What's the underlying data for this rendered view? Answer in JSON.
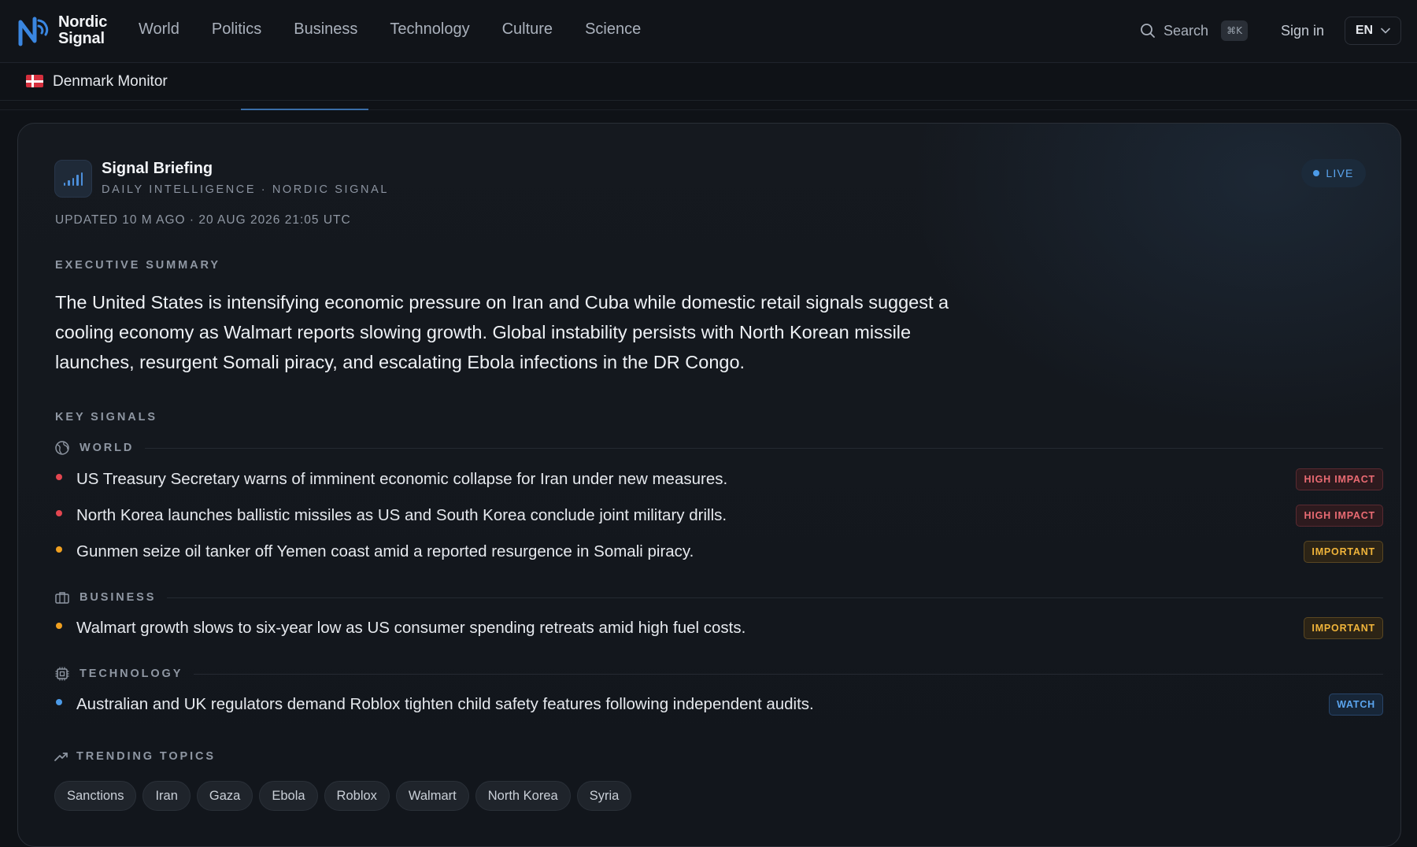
{
  "brand": {
    "name_line1": "Nordic",
    "name_line2": "Signal"
  },
  "nav": {
    "items": [
      "World",
      "Politics",
      "Business",
      "Technology",
      "Culture",
      "Science"
    ]
  },
  "header": {
    "search_label": "Search",
    "search_shortcut": "⌘K",
    "signin_label": "Sign in",
    "language": "EN"
  },
  "subbar": {
    "title": "Denmark Monitor"
  },
  "briefing": {
    "title": "Signal Briefing",
    "subtitle": "DAILY INTELLIGENCE · NORDIC SIGNAL",
    "live_label": "LIVE",
    "updated": "UPDATED 10 M AGO · 20 AUG 2026 21:05 UTC",
    "summary_label": "EXECUTIVE SUMMARY",
    "summary": "The United States is intensifying economic pressure on Iran and Cuba while domestic retail signals suggest a cooling economy as Walmart reports slowing growth. Global instability persists with North Korean missile launches, resurgent Somali piracy, and escalating Ebola infections in the DR Congo.",
    "key_signals_label": "KEY SIGNALS",
    "categories": [
      {
        "name": "WORLD",
        "icon": "globe-icon",
        "signals": [
          {
            "text": "US Treasury Secretary warns of imminent economic collapse for Iran under new measures.",
            "badge": "HIGH IMPACT",
            "level": "high"
          },
          {
            "text": "North Korea launches ballistic missiles as US and South Korea conclude joint military drills.",
            "badge": "HIGH IMPACT",
            "level": "high"
          },
          {
            "text": "Gunmen seize oil tanker off Yemen coast amid a reported resurgence in Somali piracy.",
            "badge": "IMPORTANT",
            "level": "important"
          }
        ]
      },
      {
        "name": "BUSINESS",
        "icon": "briefcase-icon",
        "signals": [
          {
            "text": "Walmart growth slows to six-year low as US consumer spending retreats amid high fuel costs.",
            "badge": "IMPORTANT",
            "level": "important"
          }
        ]
      },
      {
        "name": "TECHNOLOGY",
        "icon": "chip-icon",
        "signals": [
          {
            "text": "Australian and UK regulators demand Roblox tighten child safety features following independent audits.",
            "badge": "WATCH",
            "level": "watch"
          }
        ]
      }
    ],
    "trending_label": "TRENDING TOPICS",
    "trending": [
      "Sanctions",
      "Iran",
      "Gaza",
      "Ebola",
      "Roblox",
      "Walmart",
      "North Korea",
      "Syria"
    ]
  },
  "colors": {
    "accent": "#4c9be8",
    "high_impact": "#e34650",
    "important": "#f0a020",
    "watch": "#4c9be8",
    "flag_red": "#d5303e"
  }
}
